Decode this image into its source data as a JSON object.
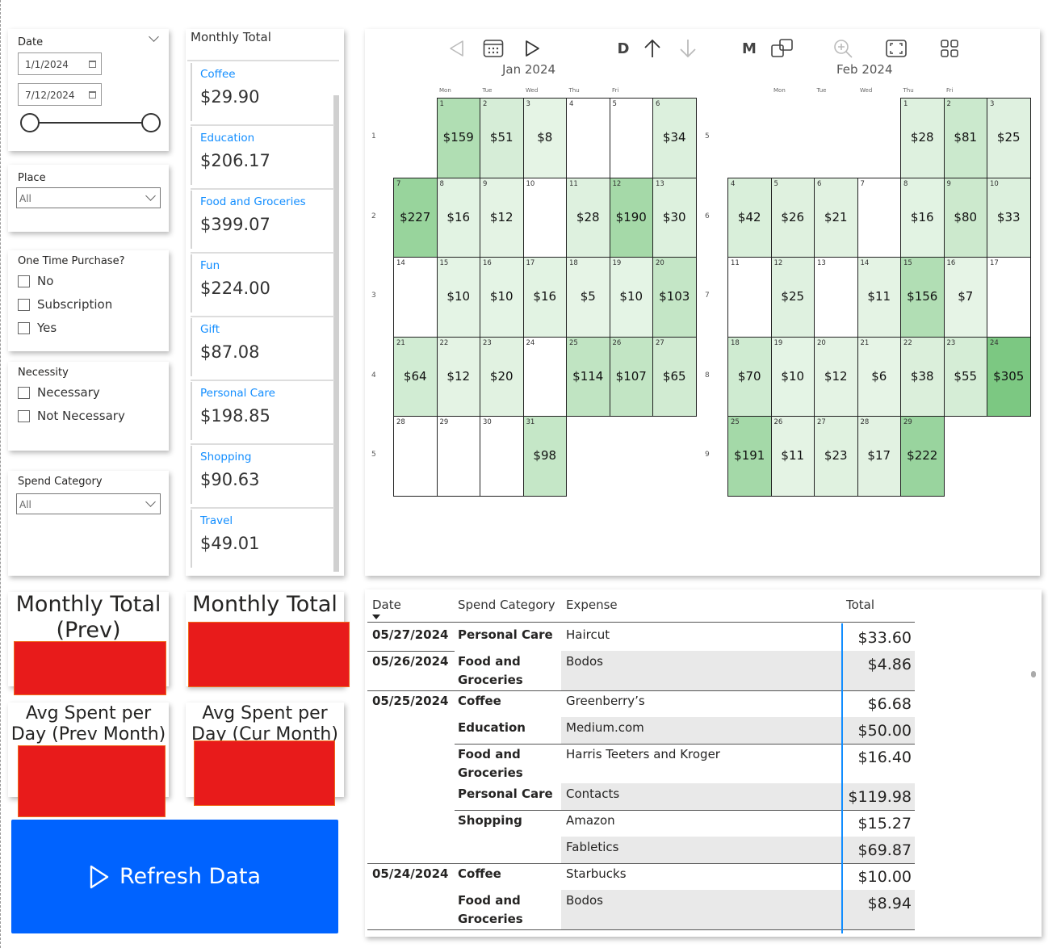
{
  "filters": {
    "date": {
      "title": "Date",
      "start": "1/1/2024",
      "end": "7/12/2024"
    },
    "place": {
      "title": "Place",
      "selected": "All"
    },
    "one_time": {
      "title": "One Time Purchase?",
      "options": [
        "No",
        "Subscription",
        "Yes"
      ]
    },
    "necessity": {
      "title": "Necessity",
      "options": [
        "Necessary",
        "Not Necessary"
      ]
    },
    "spend_category": {
      "title": "Spend Category",
      "selected": "All"
    }
  },
  "monthly_total": {
    "title": "Monthly Total",
    "items": [
      {
        "label": "Coffee",
        "value": "$29.90"
      },
      {
        "label": "Education",
        "value": "$206.17"
      },
      {
        "label": "Food and Groceries",
        "value": "$399.07"
      },
      {
        "label": "Fun",
        "value": "$224.00"
      },
      {
        "label": "Gift",
        "value": "$87.08"
      },
      {
        "label": "Personal Care",
        "value": "$198.85"
      },
      {
        "label": "Shopping",
        "value": "$90.63"
      },
      {
        "label": "Travel",
        "value": "$49.01"
      }
    ]
  },
  "kpis": {
    "prev_title_1": "Monthly Total",
    "prev_title_2": "(Prev)",
    "cur_title": "Monthly Total",
    "avg_prev_1": "Avg Spent per",
    "avg_prev_2": "Day (Prev Month)",
    "avg_cur_1": "Avg Spent per",
    "avg_cur_2": "Day (Cur Month)"
  },
  "refresh_label": "Refresh Data",
  "toolbar": {
    "d_label": "D",
    "m_label": "M"
  },
  "calendar": {
    "accent": "#5cb85c",
    "dow_labels": [
      "Mon",
      "Tue",
      "Wed",
      "Thu",
      "Fri"
    ],
    "months": [
      {
        "title": "Jan 2024",
        "weeks": [
          "1",
          "2",
          "3",
          "4",
          "5"
        ],
        "days": [
          {
            "d": 1,
            "r": 0,
            "c": 1,
            "amt": "$159",
            "v": 159
          },
          {
            "d": 2,
            "r": 0,
            "c": 2,
            "amt": "$51",
            "v": 51
          },
          {
            "d": 3,
            "r": 0,
            "c": 3,
            "amt": "$8",
            "v": 8
          },
          {
            "d": 4,
            "r": 0,
            "c": 4,
            "amt": "",
            "v": 0
          },
          {
            "d": 5,
            "r": 0,
            "c": 5,
            "amt": "",
            "v": 0
          },
          {
            "d": 6,
            "r": 0,
            "c": 6,
            "amt": "$34",
            "v": 34
          },
          {
            "d": 7,
            "r": 1,
            "c": 0,
            "amt": "$227",
            "v": 227
          },
          {
            "d": 8,
            "r": 1,
            "c": 1,
            "amt": "$16",
            "v": 16
          },
          {
            "d": 9,
            "r": 1,
            "c": 2,
            "amt": "$12",
            "v": 12
          },
          {
            "d": 10,
            "r": 1,
            "c": 3,
            "amt": "",
            "v": 0
          },
          {
            "d": 11,
            "r": 1,
            "c": 4,
            "amt": "$28",
            "v": 28
          },
          {
            "d": 12,
            "r": 1,
            "c": 5,
            "amt": "$190",
            "v": 190
          },
          {
            "d": 13,
            "r": 1,
            "c": 6,
            "amt": "$30",
            "v": 30
          },
          {
            "d": 14,
            "r": 2,
            "c": 0,
            "amt": "",
            "v": 0
          },
          {
            "d": 15,
            "r": 2,
            "c": 1,
            "amt": "$10",
            "v": 10
          },
          {
            "d": 16,
            "r": 2,
            "c": 2,
            "amt": "$10",
            "v": 10
          },
          {
            "d": 17,
            "r": 2,
            "c": 3,
            "amt": "$16",
            "v": 16
          },
          {
            "d": 18,
            "r": 2,
            "c": 4,
            "amt": "$5",
            "v": 5
          },
          {
            "d": 19,
            "r": 2,
            "c": 5,
            "amt": "$10",
            "v": 10
          },
          {
            "d": 20,
            "r": 2,
            "c": 6,
            "amt": "$103",
            "v": 103
          },
          {
            "d": 21,
            "r": 3,
            "c": 0,
            "amt": "$64",
            "v": 64
          },
          {
            "d": 22,
            "r": 3,
            "c": 1,
            "amt": "$12",
            "v": 12
          },
          {
            "d": 23,
            "r": 3,
            "c": 2,
            "amt": "$20",
            "v": 20
          },
          {
            "d": 24,
            "r": 3,
            "c": 3,
            "amt": "",
            "v": 0
          },
          {
            "d": 25,
            "r": 3,
            "c": 4,
            "amt": "$114",
            "v": 114
          },
          {
            "d": 26,
            "r": 3,
            "c": 5,
            "amt": "$107",
            "v": 107
          },
          {
            "d": 27,
            "r": 3,
            "c": 6,
            "amt": "$65",
            "v": 65
          },
          {
            "d": 28,
            "r": 4,
            "c": 0,
            "amt": "",
            "v": 0
          },
          {
            "d": 29,
            "r": 4,
            "c": 1,
            "amt": "",
            "v": 0
          },
          {
            "d": 30,
            "r": 4,
            "c": 2,
            "amt": "",
            "v": 0
          },
          {
            "d": 31,
            "r": 4,
            "c": 3,
            "amt": "$98",
            "v": 98
          }
        ]
      },
      {
        "title": "Feb 2024",
        "weeks": [
          "5",
          "6",
          "7",
          "8",
          "9"
        ],
        "days": [
          {
            "d": 1,
            "r": 0,
            "c": 4,
            "amt": "$28",
            "v": 28
          },
          {
            "d": 2,
            "r": 0,
            "c": 5,
            "amt": "$81",
            "v": 81
          },
          {
            "d": 3,
            "r": 0,
            "c": 6,
            "amt": "$25",
            "v": 25
          },
          {
            "d": 4,
            "r": 1,
            "c": 0,
            "amt": "$42",
            "v": 42
          },
          {
            "d": 5,
            "r": 1,
            "c": 1,
            "amt": "$26",
            "v": 26
          },
          {
            "d": 6,
            "r": 1,
            "c": 2,
            "amt": "$21",
            "v": 21
          },
          {
            "d": 7,
            "r": 1,
            "c": 3,
            "amt": "",
            "v": 0
          },
          {
            "d": 8,
            "r": 1,
            "c": 4,
            "amt": "$16",
            "v": 16
          },
          {
            "d": 9,
            "r": 1,
            "c": 5,
            "amt": "$80",
            "v": 80
          },
          {
            "d": 10,
            "r": 1,
            "c": 6,
            "amt": "$33",
            "v": 33
          },
          {
            "d": 11,
            "r": 2,
            "c": 0,
            "amt": "",
            "v": 0
          },
          {
            "d": 12,
            "r": 2,
            "c": 1,
            "amt": "$25",
            "v": 25
          },
          {
            "d": 13,
            "r": 2,
            "c": 2,
            "amt": "",
            "v": 0
          },
          {
            "d": 14,
            "r": 2,
            "c": 3,
            "amt": "$11",
            "v": 11
          },
          {
            "d": 15,
            "r": 2,
            "c": 4,
            "amt": "$156",
            "v": 156
          },
          {
            "d": 16,
            "r": 2,
            "c": 5,
            "amt": "$7",
            "v": 7
          },
          {
            "d": 17,
            "r": 2,
            "c": 6,
            "amt": "",
            "v": 0
          },
          {
            "d": 18,
            "r": 3,
            "c": 0,
            "amt": "$70",
            "v": 70
          },
          {
            "d": 19,
            "r": 3,
            "c": 1,
            "amt": "$10",
            "v": 10
          },
          {
            "d": 20,
            "r": 3,
            "c": 2,
            "amt": "$12",
            "v": 12
          },
          {
            "d": 21,
            "r": 3,
            "c": 3,
            "amt": "$6",
            "v": 6
          },
          {
            "d": 22,
            "r": 3,
            "c": 4,
            "amt": "$38",
            "v": 38
          },
          {
            "d": 23,
            "r": 3,
            "c": 5,
            "amt": "$55",
            "v": 55
          },
          {
            "d": 24,
            "r": 3,
            "c": 6,
            "amt": "$305",
            "v": 305
          },
          {
            "d": 25,
            "r": 4,
            "c": 0,
            "amt": "$191",
            "v": 191
          },
          {
            "d": 26,
            "r": 4,
            "c": 1,
            "amt": "$11",
            "v": 11
          },
          {
            "d": 27,
            "r": 4,
            "c": 2,
            "amt": "$23",
            "v": 23
          },
          {
            "d": 28,
            "r": 4,
            "c": 3,
            "amt": "$17",
            "v": 17
          },
          {
            "d": 29,
            "r": 4,
            "c": 4,
            "amt": "$222",
            "v": 222
          }
        ]
      }
    ]
  },
  "table": {
    "headers": {
      "date": "Date",
      "category": "Spend Category",
      "expense": "Expense",
      "total": "Total"
    },
    "rows": [
      {
        "date": "05/27/2024",
        "category": "Personal Care",
        "expense": "Haircut",
        "total": "$33.60"
      },
      {
        "date": "05/26/2024",
        "category": "Food and Groceries",
        "expense": "Bodos",
        "total": "$4.86"
      },
      {
        "date": "05/25/2024",
        "category": "Coffee",
        "expense": "Greenberry’s",
        "total": "$6.68"
      },
      {
        "date": "",
        "category": "Education",
        "expense": "Medium.com",
        "total": "$50.00"
      },
      {
        "date": "",
        "category": "Food and Groceries",
        "expense": "Harris Teeters and Kroger",
        "total": "$16.40"
      },
      {
        "date": "",
        "category": "Personal Care",
        "expense": "Contacts",
        "total": "$119.98"
      },
      {
        "date": "",
        "category": "Shopping",
        "expense": "Amazon",
        "total": "$15.27"
      },
      {
        "date": "",
        "category": "",
        "expense": "Fabletics",
        "total": "$69.87"
      },
      {
        "date": "05/24/2024",
        "category": "Coffee",
        "expense": "Starbucks",
        "total": "$10.00"
      },
      {
        "date": "",
        "category": "Food and Groceries",
        "expense": "Bodos",
        "total": "$8.94"
      }
    ]
  }
}
